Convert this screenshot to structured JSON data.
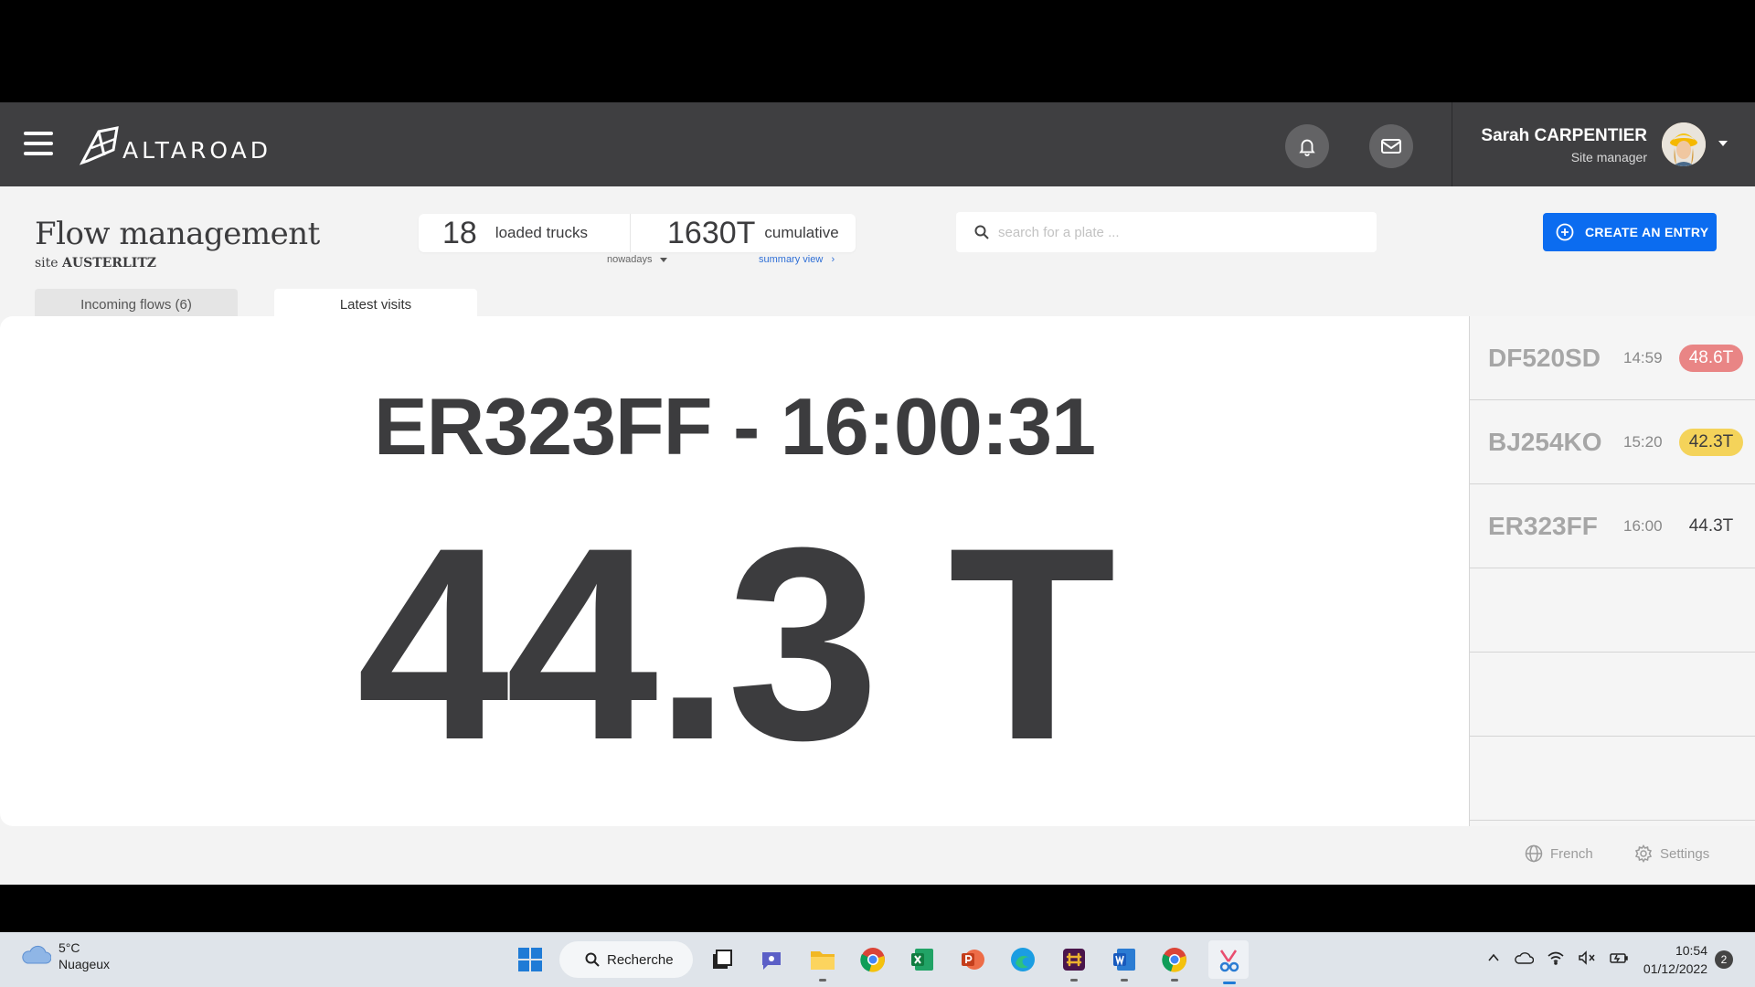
{
  "app": {
    "brand": "ALTAROAD",
    "user": {
      "name": "Sarah CARPENTIER",
      "role": "Site manager"
    }
  },
  "header": {
    "title": "Flow management",
    "site_prefix": "site",
    "site_name": "AUSTERLITZ",
    "stats": {
      "trucks_value": "18",
      "trucks_label": "loaded trucks",
      "cumulative_value": "1630T",
      "cumulative_label": "cumulative",
      "period": "nowadays",
      "summary_link": "summary view"
    },
    "search": {
      "placeholder": "search for a plate ...",
      "value": ""
    },
    "create_button": "CREATE AN ENTRY"
  },
  "tabs": [
    {
      "label": "Incoming flows (6)",
      "active": false
    },
    {
      "label": "Latest visits",
      "active": true
    }
  ],
  "current_visit": {
    "title": "ER323FF - 16:00:31",
    "weight": "44.3 T"
  },
  "latest_visits": [
    {
      "plate": "DF520SD",
      "time": "14:59",
      "weight": "48.6T",
      "status": "red",
      "color": "#e98585"
    },
    {
      "plate": "BJ254KO",
      "time": "15:20",
      "weight": "42.3T",
      "status": "yellow",
      "color": "#f4d35a"
    },
    {
      "plate": "ER323FF",
      "time": "16:00",
      "weight": "44.3T",
      "status": "normal"
    }
  ],
  "footer": {
    "language": "French",
    "settings": "Settings"
  },
  "taskbar": {
    "weather_temp": "5°C",
    "weather_desc": "Nuageux",
    "search_label": "Recherche",
    "time": "10:54",
    "date": "01/12/2022",
    "notifications": "2"
  },
  "colors": {
    "accent": "#0b6cf0",
    "topbar": "#3f3f41",
    "text": "#3c3c3e"
  }
}
